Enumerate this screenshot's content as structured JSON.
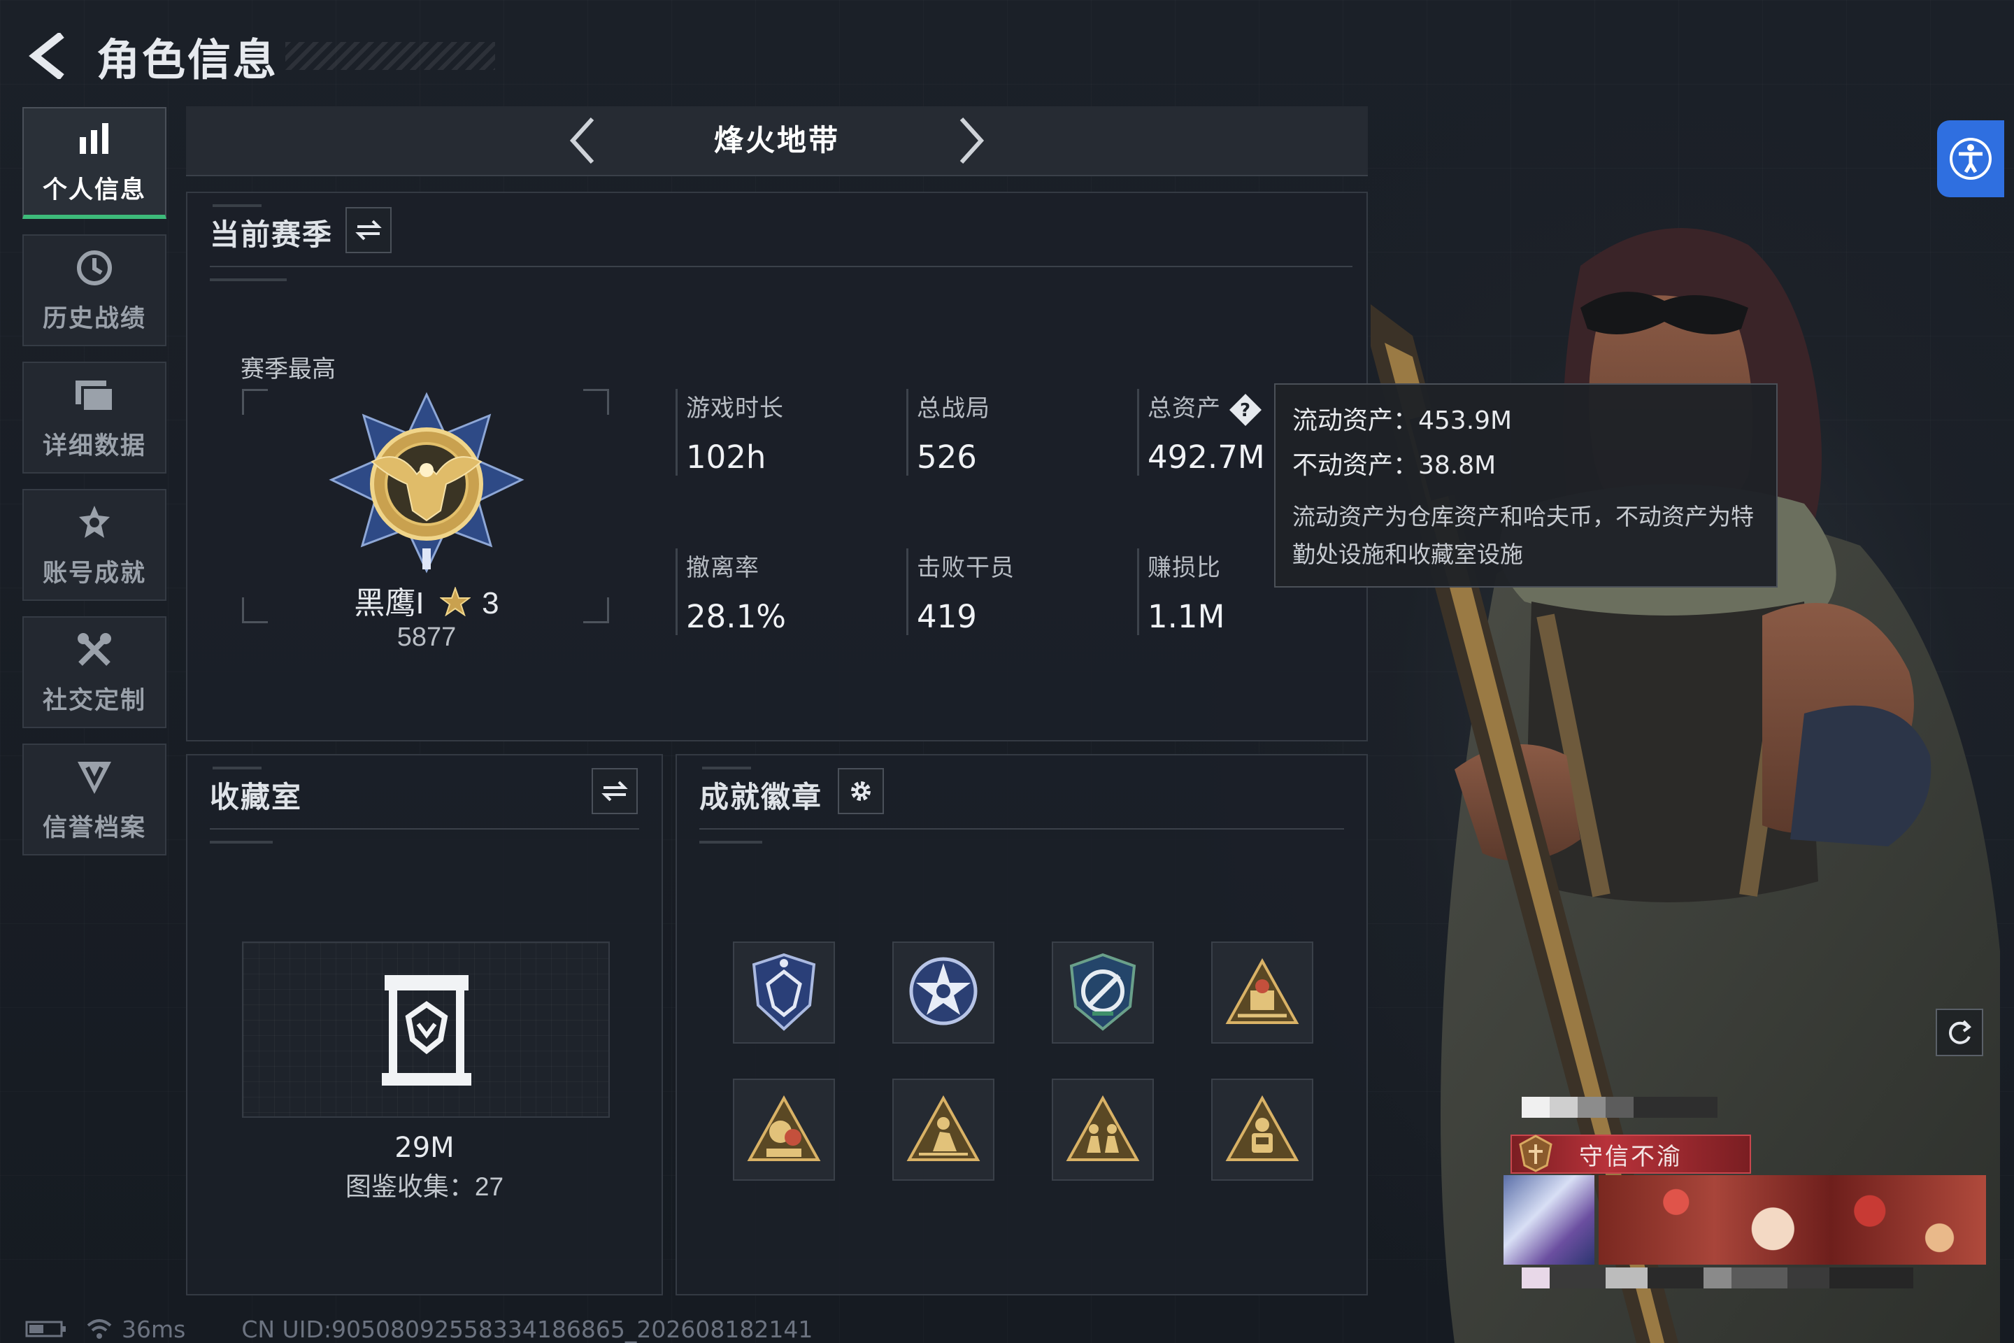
{
  "header": {
    "title": "角色信息"
  },
  "sidebar": {
    "items": [
      {
        "label": "个人信息",
        "icon": "bar-chart-icon",
        "active": true
      },
      {
        "label": "历史战绩",
        "icon": "history-icon",
        "active": false
      },
      {
        "label": "详细数据",
        "icon": "folder-icon",
        "active": false
      },
      {
        "label": "账号成就",
        "icon": "achievement-icon",
        "active": false
      },
      {
        "label": "社交定制",
        "icon": "tools-icon",
        "active": false
      },
      {
        "label": "信誉档案",
        "icon": "credit-icon",
        "active": false
      }
    ]
  },
  "mode": {
    "title": "烽火地带"
  },
  "season": {
    "title": "当前赛季",
    "best_label": "赛季最高",
    "rank": {
      "name": "黑鹰I",
      "stars": "3",
      "score": "5877"
    },
    "stats": [
      {
        "label": "游戏时长",
        "value": "102h"
      },
      {
        "label": "总战局",
        "value": "526"
      },
      {
        "label": "总资产",
        "value": "492.7M"
      },
      {
        "label": "撤离率",
        "value": "28.1%"
      },
      {
        "label": "击败干员",
        "value": "419"
      },
      {
        "label": "赚损比",
        "value": "1.1M"
      }
    ]
  },
  "tooltip": {
    "liquid": "流动资产：453.9M",
    "fixed": "不动资产：38.8M",
    "description": "流动资产为仓库资产和哈夫币，不动资产为特勤处设施和收藏室设施"
  },
  "collection": {
    "title": "收藏室",
    "value": "29M",
    "count": "图鉴收集：27"
  },
  "badges": {
    "title": "成就徽章",
    "items": [
      "shield-badge-icon",
      "star-badge-icon",
      "emblem-badge-icon",
      "triangle-badge-icon",
      "triangle-badge-icon",
      "triangle-badge-icon",
      "triangle-badge-icon",
      "triangle-badge-icon"
    ]
  },
  "character": {
    "banner": "守信不渝"
  },
  "footer": {
    "ping": "36ms",
    "uid": "CN UID:905080925583341868​65_202608182141"
  },
  "colors": {
    "accent": "#3dbb7a",
    "accessibility": "#2f6fe0",
    "banner": "#b8323a"
  }
}
